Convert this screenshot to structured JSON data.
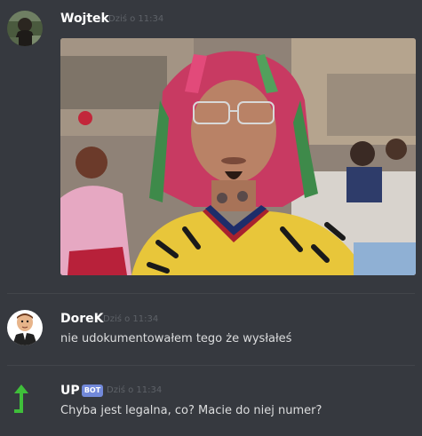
{
  "messages": [
    {
      "username": "Wojtek",
      "timestamp": "Dziś o 11:34",
      "avatar_icon": "hooded-figure-avatar",
      "attachment": "image"
    },
    {
      "username": "DoreK",
      "timestamp": "Dziś o 11:34",
      "avatar_icon": "cartoon-man-avatar",
      "text": "nie udokumentowałem tego że wysłałeś"
    },
    {
      "username": "UP",
      "badge": "BOT",
      "timestamp": "Dziś o 11:34",
      "avatar_icon": "green-arrow-up-avatar",
      "text": "Chyba jest legalna, co? Macie do niej numer?"
    }
  ],
  "colors": {
    "background": "#36393f",
    "username": "#ffffff",
    "text": "#dcddde",
    "timestamp": "#5e6268",
    "bot_badge": "#7289da",
    "divider": "#42454a"
  }
}
